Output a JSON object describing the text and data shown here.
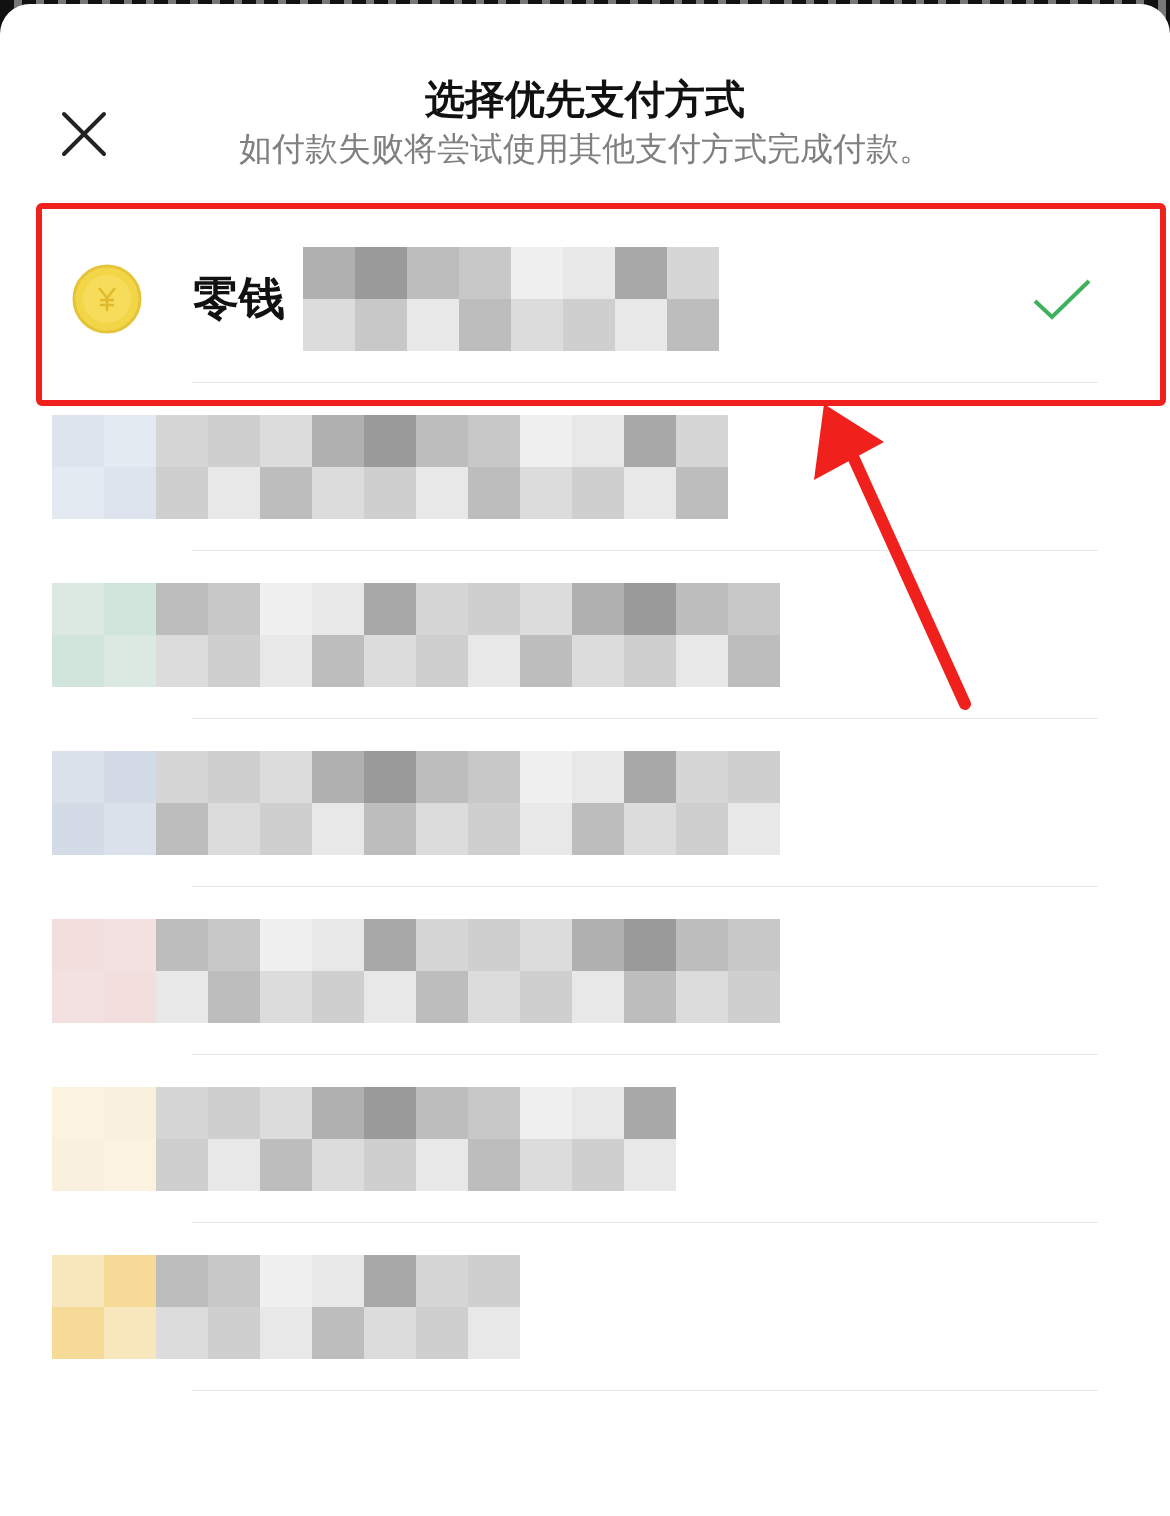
{
  "header": {
    "title": "选择优先支付方式",
    "subtitle": "如付款失败将尝试使用其他支付方式完成付款。"
  },
  "payment_methods": [
    {
      "kind": "wallet",
      "label": "零钱",
      "selected": true,
      "highlighted": true
    },
    {
      "kind": "redacted",
      "selected": false,
      "highlighted": false
    },
    {
      "kind": "redacted",
      "selected": false,
      "highlighted": false
    },
    {
      "kind": "redacted",
      "selected": false,
      "highlighted": false
    },
    {
      "kind": "redacted",
      "selected": false,
      "highlighted": false
    },
    {
      "kind": "redacted",
      "selected": false,
      "highlighted": false
    },
    {
      "kind": "redacted",
      "selected": false,
      "highlighted": false
    }
  ]
}
